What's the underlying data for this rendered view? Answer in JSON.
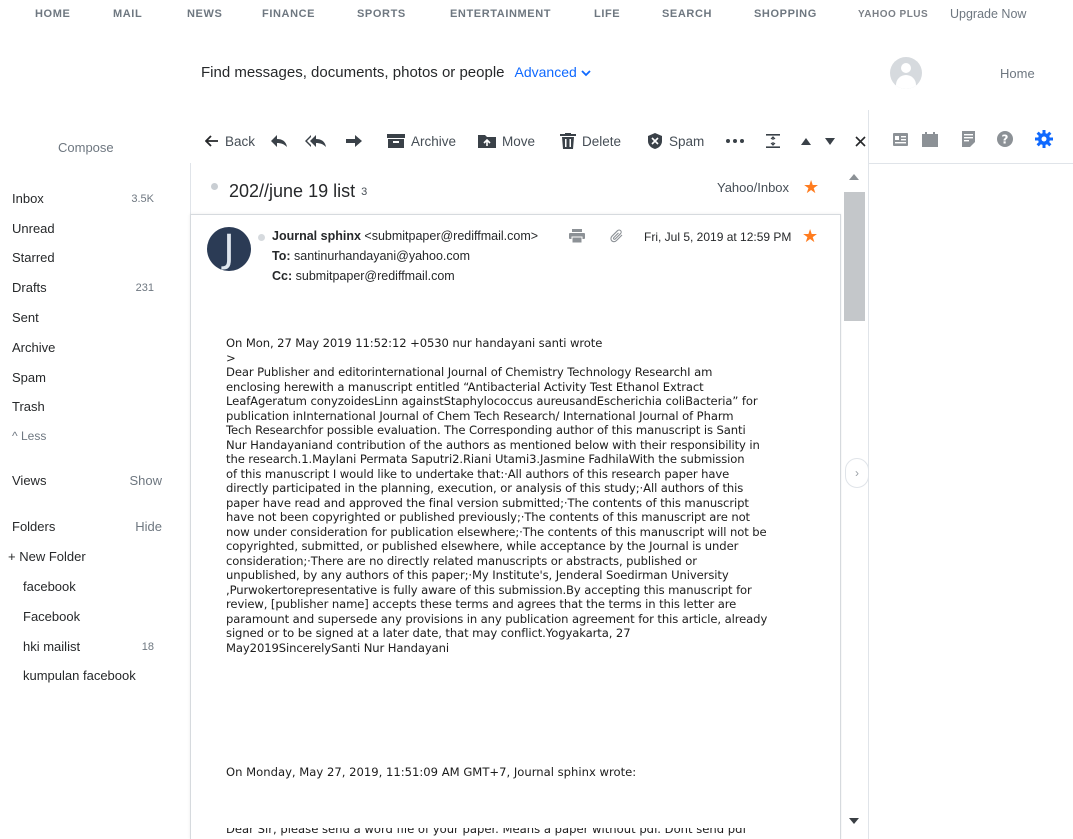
{
  "topnav": {
    "items": [
      "HOME",
      "MAIL",
      "NEWS",
      "FINANCE",
      "SPORTS",
      "ENTERTAINMENT",
      "LIFE",
      "SEARCH",
      "SHOPPING"
    ],
    "brand": "YAHOO PLUS",
    "upgrade": "Upgrade Now"
  },
  "search": {
    "placeholder": "Find messages, documents, photos or people",
    "advanced": "Advanced"
  },
  "header": {
    "home": "Home"
  },
  "sidebar": {
    "compose": "Compose",
    "items": [
      {
        "label": "Inbox",
        "count": "3.5K"
      },
      {
        "label": "Unread",
        "count": ""
      },
      {
        "label": "Starred",
        "count": ""
      },
      {
        "label": "Drafts",
        "count": "231"
      },
      {
        "label": "Sent",
        "count": ""
      },
      {
        "label": "Archive",
        "count": ""
      },
      {
        "label": "Spam",
        "count": ""
      },
      {
        "label": "Trash",
        "count": ""
      }
    ],
    "less": "^ Less",
    "views": {
      "label": "Views",
      "action": "Show"
    },
    "folders": {
      "label": "Folders",
      "action": "Hide"
    },
    "new_folder": "+ New Folder",
    "folder_items": [
      {
        "label": "facebook",
        "count": ""
      },
      {
        "label": "Facebook",
        "count": ""
      },
      {
        "label": "hki mailist",
        "count": "18"
      },
      {
        "label": "kumpulan facebook",
        "count": ""
      }
    ]
  },
  "toolbar": {
    "back": "Back",
    "archive": "Archive",
    "move": "Move",
    "delete": "Delete",
    "spam": "Spam"
  },
  "message": {
    "subject": "202//june 19 list",
    "thread_count": "3",
    "folder": "Yahoo/Inbox",
    "sender_initial": "J",
    "from_name": "Journal sphinx",
    "from_email": "<submitpaper@rediffmail.com>",
    "to_label": "To:",
    "to": "santinurhandayani@yahoo.com",
    "cc_label": "Cc:",
    "cc": "submitpaper@rediffmail.com",
    "date": "Fri, Jul 5, 2019 at 12:59 PM",
    "body_lines": [
      "On Mon, 27 May 2019 11:52:12 +0530 nur handayani santi wrote",
      ">",
      "Dear Publisher and editorinternational Journal of Chemistry Technology ResearchI am",
      "enclosing herewith a manuscript entitled “Antibacterial Activity Test Ethanol Extract",
      "LeafAgeratum conyzoidesLinn againstStaphylococcus aureusandEscherichia coliBacteria” for",
      "publication inInternational Journal of Chem Tech Research/ International Journal of Pharm",
      "Tech Researchfor possible evaluation. The Corresponding author of this manuscript is Santi",
      "Nur Handayaniand contribution of the authors as mentioned below with their responsibility in",
      "the research.1.Maylani Permata Saputri2.Riani Utami3.Jasmine FadhilaWith the submission",
      "of this manuscript I would like to undertake that:·All authors of this research paper have",
      "directly participated in the planning, execution, or analysis of this study;·All authors of this",
      "paper have read and approved the final version submitted;·The contents of this manuscript",
      "have not been copyrighted or published previously;·The contents of this manuscript are not",
      "now under consideration for publication elsewhere;·The contents of this manuscript will not be",
      "copyrighted, submitted, or published elsewhere, while acceptance by the Journal is under",
      "consideration;·There are no directly related manuscripts or abstracts, published or",
      "unpublished, by any authors of this paper;·My Institute's, Jenderal Soedirman University",
      ",Purwokertorepresentative is fully aware of this submission.By accepting this manuscript for",
      "review, [publisher name] accepts these terms and agrees that the terms in this letter are",
      "paramount and supersede any provisions in any publication agreement for this article, already",
      "signed or to be signed at a later date, that may conflict.Yogyakarta, 27",
      "May2019SincerelySanti Nur Handayani"
    ],
    "quote_header": "On Monday, May 27, 2019, 11:51:09 AM GMT+7, Journal sphinx wrote:",
    "cut_line": "Dear Sir, please send a word file of your paper. Means a paper without pdf. Dont send pdf"
  },
  "colors": {
    "accent": "#0f69ff",
    "star": "#ff7c1f",
    "settings": "#0f69ff"
  }
}
